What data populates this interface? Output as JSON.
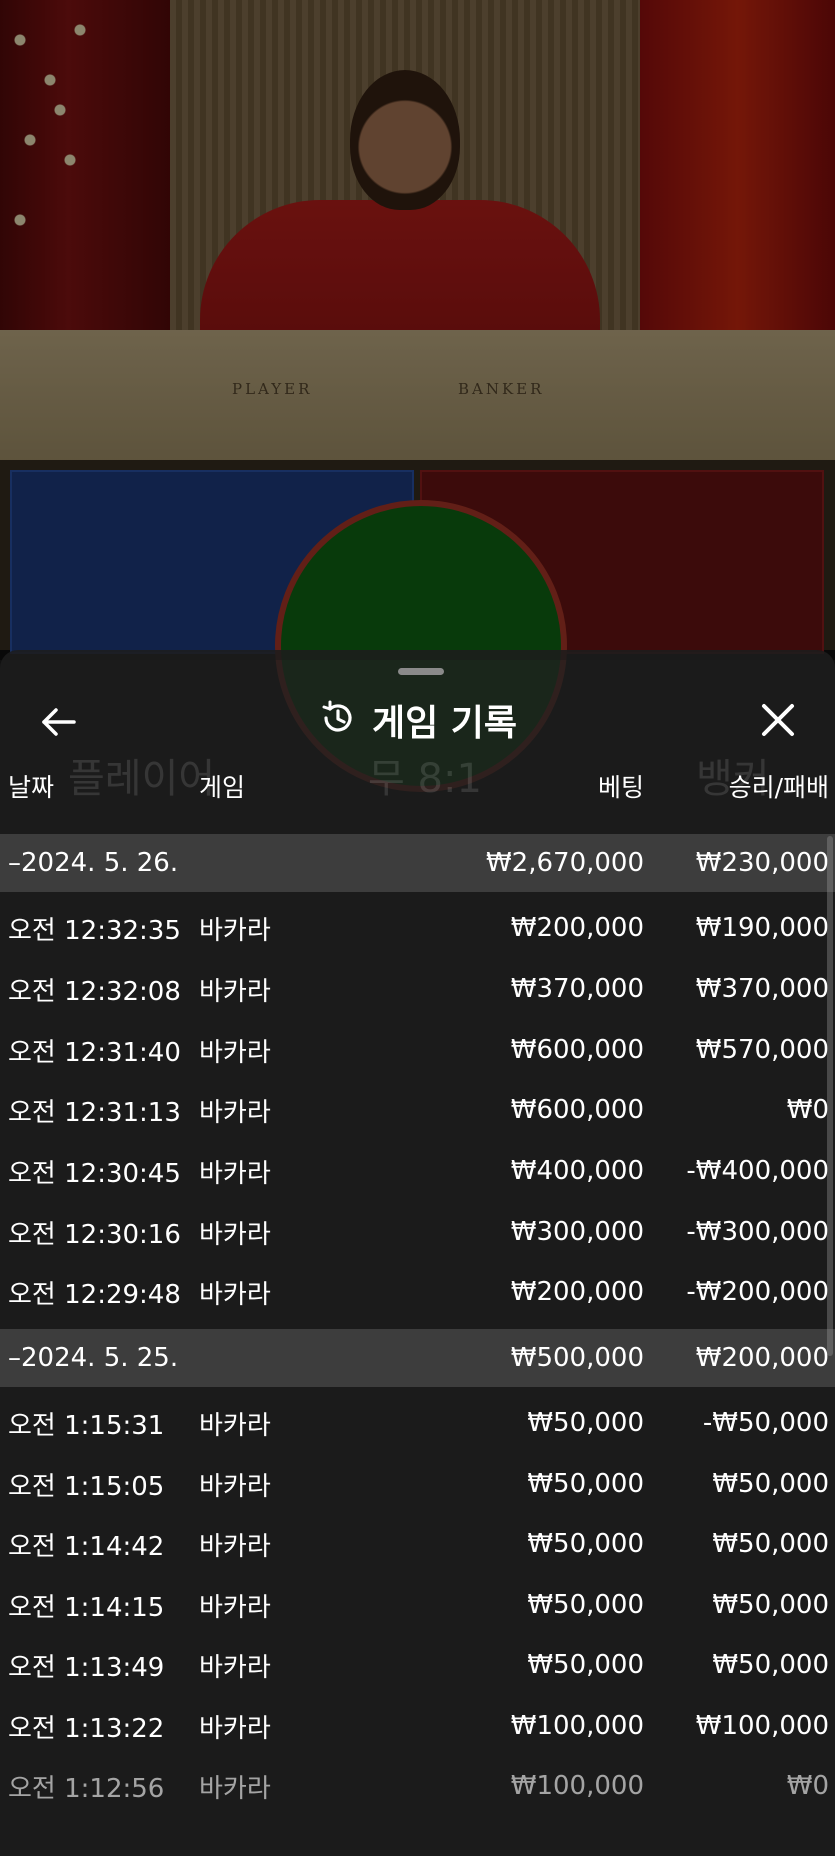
{
  "video": {
    "felt_player": "PLAYER",
    "felt_banker": "BANKER"
  },
  "background_labels": {
    "player": "플레이어",
    "tie": "무 8:1",
    "banker": "뱅커"
  },
  "sheet": {
    "title": "게임 기록",
    "columns": {
      "date": "날짜",
      "game": "게임",
      "bet": "베팅",
      "result": "승리/패배"
    },
    "groups": [
      {
        "date": "–2024. 5. 26.",
        "bet_total": "₩2,670,000",
        "result_total": "₩230,000",
        "rows": [
          {
            "time": "오전 12:32:35",
            "game": "바카라",
            "bet": "₩200,000",
            "result": "₩190,000"
          },
          {
            "time": "오전 12:32:08",
            "game": "바카라",
            "bet": "₩370,000",
            "result": "₩370,000"
          },
          {
            "time": "오전 12:31:40",
            "game": "바카라",
            "bet": "₩600,000",
            "result": "₩570,000"
          },
          {
            "time": "오전 12:31:13",
            "game": "바카라",
            "bet": "₩600,000",
            "result": "₩0"
          },
          {
            "time": "오전 12:30:45",
            "game": "바카라",
            "bet": "₩400,000",
            "result": "-₩400,000"
          },
          {
            "time": "오전 12:30:16",
            "game": "바카라",
            "bet": "₩300,000",
            "result": "-₩300,000"
          },
          {
            "time": "오전 12:29:48",
            "game": "바카라",
            "bet": "₩200,000",
            "result": "-₩200,000"
          }
        ]
      },
      {
        "date": "–2024. 5. 25.",
        "bet_total": "₩500,000",
        "result_total": "₩200,000",
        "rows": [
          {
            "time": "오전 1:15:31",
            "game": "바카라",
            "bet": "₩50,000",
            "result": "-₩50,000"
          },
          {
            "time": "오전 1:15:05",
            "game": "바카라",
            "bet": "₩50,000",
            "result": "₩50,000"
          },
          {
            "time": "오전 1:14:42",
            "game": "바카라",
            "bet": "₩50,000",
            "result": "₩50,000"
          },
          {
            "time": "오전 1:14:15",
            "game": "바카라",
            "bet": "₩50,000",
            "result": "₩50,000"
          },
          {
            "time": "오전 1:13:49",
            "game": "바카라",
            "bet": "₩50,000",
            "result": "₩50,000"
          },
          {
            "time": "오전 1:13:22",
            "game": "바카라",
            "bet": "₩100,000",
            "result": "₩100,000"
          },
          {
            "time": "오전 1:12:56",
            "game": "바카라",
            "bet": "₩100,000",
            "result": "₩0"
          }
        ]
      }
    ]
  },
  "icons": {
    "back": "arrow-left-icon",
    "history": "history-clock-icon",
    "close": "close-icon"
  }
}
